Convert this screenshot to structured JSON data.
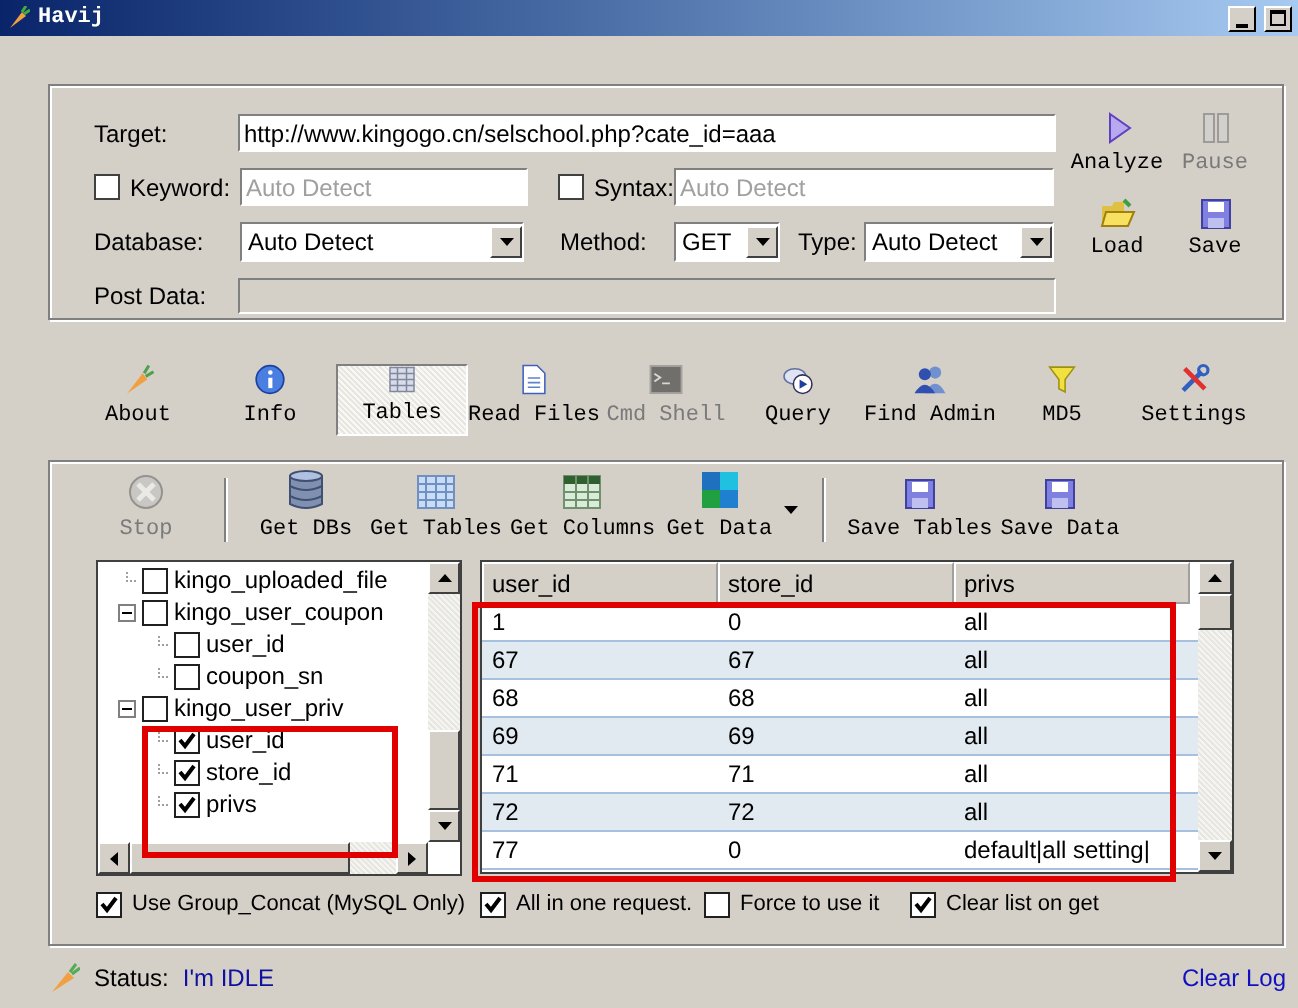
{
  "window": {
    "title": "Havij"
  },
  "target": {
    "label": "Target:",
    "value": "http://www.kingogo.cn/selschool.php?cate_id=aaa"
  },
  "keyword": {
    "label": "Keyword:",
    "checked": false,
    "placeholder": "Auto Detect"
  },
  "syntax": {
    "label": "Syntax:",
    "checked": false,
    "placeholder": "Auto Detect"
  },
  "database": {
    "label": "Database:",
    "value": "Auto Detect"
  },
  "method": {
    "label": "Method:",
    "value": "GET"
  },
  "type": {
    "label": "Type:",
    "value": "Auto Detect"
  },
  "post_data": {
    "label": "Post Data:",
    "disabled": true
  },
  "side_buttons": [
    {
      "label": "Analyze",
      "kind": "play",
      "disabled": false
    },
    {
      "label": "Pause",
      "kind": "pause",
      "disabled": true
    },
    {
      "label": "Load",
      "kind": "folder",
      "disabled": false
    },
    {
      "label": "Save",
      "kind": "disk",
      "disabled": false
    }
  ],
  "tabs": [
    {
      "label": "About",
      "kind": "carrot",
      "selected": false,
      "disabled": false
    },
    {
      "label": "Info",
      "kind": "info",
      "selected": false,
      "disabled": false
    },
    {
      "label": "Tables",
      "kind": "table",
      "selected": true,
      "disabled": false
    },
    {
      "label": "Read Files",
      "kind": "file",
      "selected": false,
      "disabled": false
    },
    {
      "label": "Cmd Shell",
      "kind": "terminal",
      "selected": false,
      "disabled": true
    },
    {
      "label": "Query",
      "kind": "query",
      "selected": false,
      "disabled": false
    },
    {
      "label": "Find Admin",
      "kind": "users",
      "selected": false,
      "disabled": false
    },
    {
      "label": "MD5",
      "kind": "funnel",
      "selected": false,
      "disabled": false
    },
    {
      "label": "Settings",
      "kind": "tools",
      "selected": false,
      "disabled": false
    }
  ],
  "toolbar": [
    {
      "kind": "stop",
      "label": "Stop",
      "disabled": true
    },
    {
      "kind": "separator"
    },
    {
      "kind": "database",
      "label": "Get DBs",
      "disabled": false
    },
    {
      "kind": "grid",
      "label": "Get Tables",
      "disabled": false
    },
    {
      "kind": "columns",
      "label": "Get Columns",
      "disabled": false
    },
    {
      "kind": "data",
      "label": "Get Data",
      "disabled": false
    },
    {
      "kind": "dropdown"
    },
    {
      "kind": "separator"
    },
    {
      "kind": "disk",
      "label": "Save Tables",
      "disabled": false
    },
    {
      "kind": "disk",
      "label": "Save Data",
      "disabled": false
    }
  ],
  "tree": [
    {
      "label": "kingo_uploaded_file",
      "checked": false
    },
    {
      "label": "kingo_user_coupon",
      "checked": false,
      "expanded": true,
      "children": [
        {
          "label": "user_id",
          "checked": false
        },
        {
          "label": "coupon_sn",
          "checked": false
        }
      ]
    },
    {
      "label": "kingo_user_priv",
      "checked": false,
      "expanded": true,
      "children": [
        {
          "label": "user_id",
          "checked": true
        },
        {
          "label": "store_id",
          "checked": true
        },
        {
          "label": "privs",
          "checked": true
        }
      ]
    }
  ],
  "grid": {
    "columns": [
      "user_id",
      "store_id",
      "privs"
    ],
    "rows": [
      [
        "1",
        "0",
        "all"
      ],
      [
        "67",
        "67",
        "all"
      ],
      [
        "68",
        "68",
        "all"
      ],
      [
        "69",
        "69",
        "all"
      ],
      [
        "71",
        "71",
        "all"
      ],
      [
        "72",
        "72",
        "all"
      ],
      [
        "77",
        "0",
        "default|all setting|"
      ]
    ]
  },
  "options": [
    {
      "label": "Use Group_Concat (MySQL Only)",
      "checked": true
    },
    {
      "label": "All in one request.",
      "checked": true
    },
    {
      "label": "Force to use it",
      "checked": false
    },
    {
      "label": "Clear list on get",
      "checked": true
    }
  ],
  "status": {
    "label": "Status:",
    "value": "I'm IDLE"
  },
  "clear_log": "Clear Log"
}
